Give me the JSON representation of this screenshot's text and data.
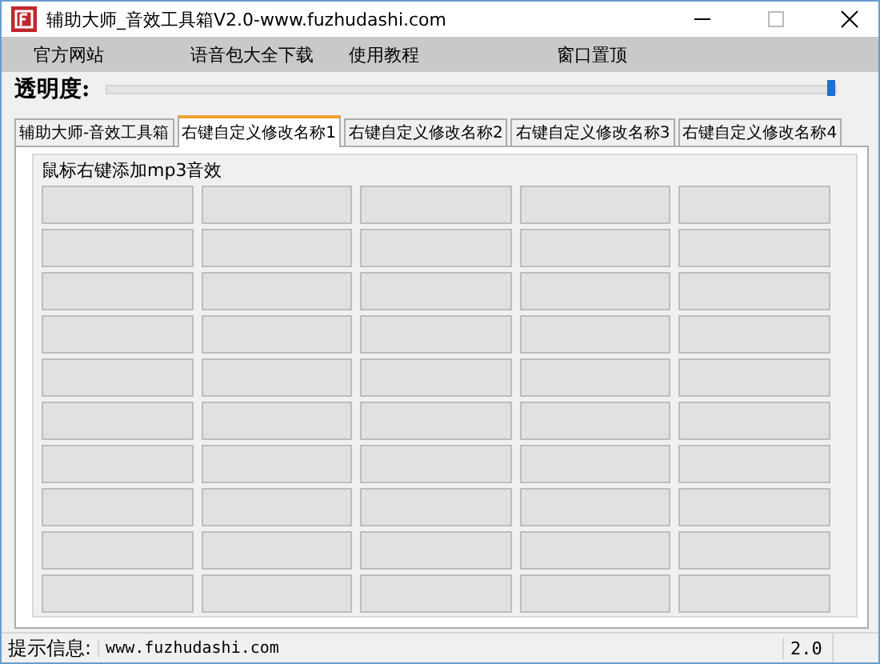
{
  "window": {
    "title": "辅助大师_音效工具箱V2.0-www.fuzhudashi.com"
  },
  "menu": [
    "官方网站",
    "语音包大全下载",
    "使用教程",
    "窗口置顶"
  ],
  "opacity": {
    "label": "透明度:",
    "level": 1
  },
  "tabs": [
    {
      "label": "辅助大师-音效工具箱",
      "selected": false
    },
    {
      "label": "右键自定义修改名称1",
      "selected": true
    },
    {
      "label": "右键自定义修改名称2",
      "selected": false
    },
    {
      "label": "右键自定义修改名称3",
      "selected": false
    },
    {
      "label": "右键自定义修改名称4",
      "selected": false
    }
  ],
  "group": {
    "title": "鼠标右键添加mp3音效"
  },
  "status_bar": {
    "label": "提示信息:",
    "message": "www.fuzhudashi.com",
    "version": "2.0"
  }
}
